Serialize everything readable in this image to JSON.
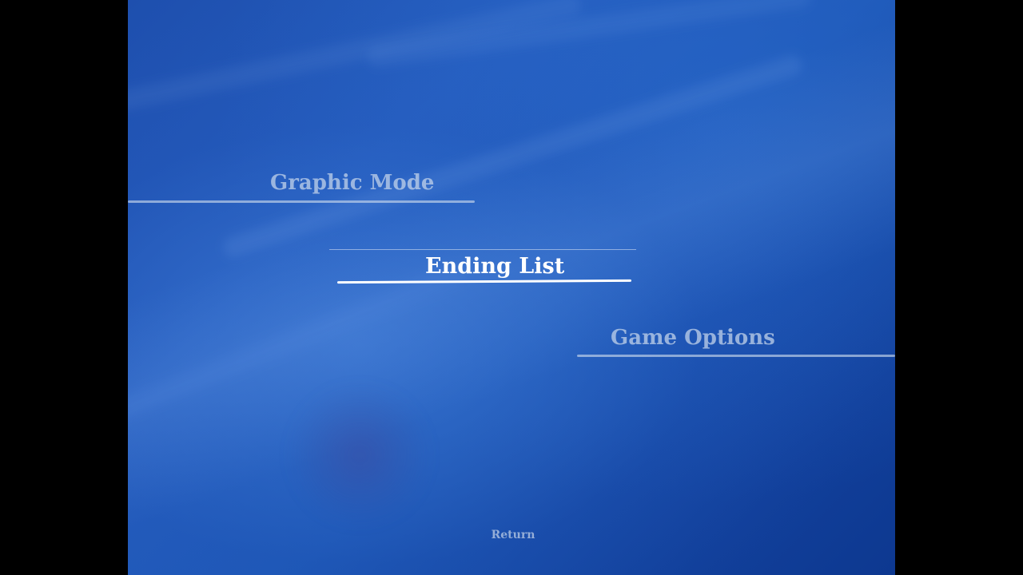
{
  "menu": {
    "items": [
      {
        "label": "Graphic Mode",
        "state": "inactive"
      },
      {
        "label": "Ending List",
        "state": "selected"
      },
      {
        "label": "Game Options",
        "state": "inactive"
      }
    ]
  },
  "footer": {
    "return_label": "Return"
  },
  "colors": {
    "background_primary": "#1e4fae",
    "background_secondary": "#113f9a",
    "selected_text": "#ffffff",
    "inactive_text": "#c8d7eb",
    "letterbox": "#000000"
  }
}
